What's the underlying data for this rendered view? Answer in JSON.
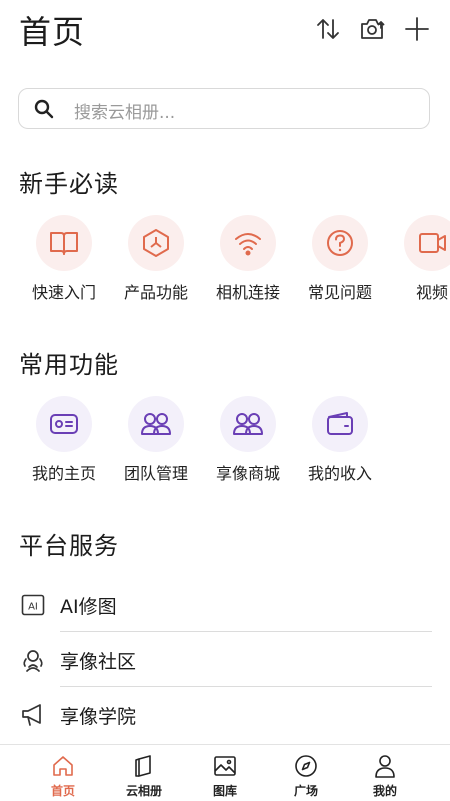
{
  "header": {
    "title": "首页"
  },
  "search": {
    "placeholder": "搜索云相册..."
  },
  "section1": {
    "title": "新手必读",
    "items": [
      {
        "label": "快速入门",
        "icon": "book-icon"
      },
      {
        "label": "产品功能",
        "icon": "cube-icon"
      },
      {
        "label": "相机连接",
        "icon": "wifi-icon"
      },
      {
        "label": "常见问题",
        "icon": "question-icon"
      },
      {
        "label": "视频",
        "icon": "video-icon"
      }
    ]
  },
  "section2": {
    "title": "常用功能",
    "items": [
      {
        "label": "我的主页",
        "icon": "id-card-icon"
      },
      {
        "label": "团队管理",
        "icon": "team-icon"
      },
      {
        "label": "享像商城",
        "icon": "shop-icon"
      },
      {
        "label": "我的收入",
        "icon": "wallet-icon"
      }
    ]
  },
  "section3": {
    "title": "平台服务",
    "items": [
      {
        "label": "AI修图",
        "icon": "ai-icon"
      },
      {
        "label": "享像社区",
        "icon": "community-icon"
      },
      {
        "label": "享像学院",
        "icon": "megaphone-icon"
      }
    ]
  },
  "tabs": [
    {
      "label": "首页",
      "icon": "home-icon",
      "active": true
    },
    {
      "label": "云相册",
      "icon": "album-icon"
    },
    {
      "label": "图库",
      "icon": "gallery-icon"
    },
    {
      "label": "广场",
      "icon": "compass-icon"
    },
    {
      "label": "我的",
      "icon": "profile-icon"
    }
  ],
  "colors": {
    "accent": "#e06a4d",
    "accent_bg": "#fbeeed",
    "purple": "#6a3fb5",
    "purple_bg": "#f3f0fa"
  }
}
